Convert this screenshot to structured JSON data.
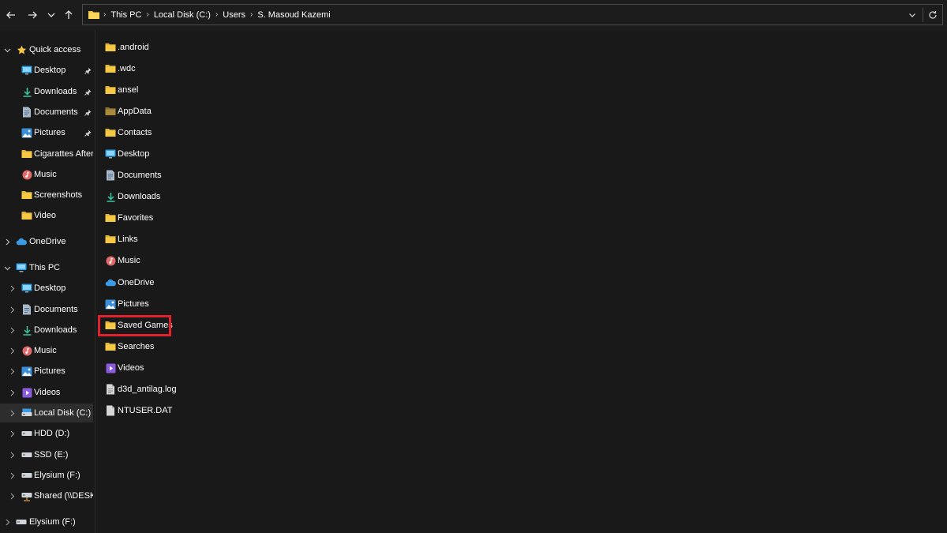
{
  "toolbar": {
    "back_icon": "arrow-left-icon",
    "forward_icon": "arrow-right-icon",
    "recent_icon": "chevron-down-icon",
    "up_icon": "arrow-up-icon"
  },
  "address": {
    "crumbs": [
      "This PC",
      "Local Disk (C:)",
      "Users",
      "S. Masoud Kazemi"
    ],
    "dropdown_icon": "chevron-down-icon",
    "refresh_icon": "refresh-icon"
  },
  "sidebar": {
    "quick_access": {
      "label": "Quick access",
      "items": [
        {
          "label": "Desktop",
          "icon": "desktop-icon",
          "pinned": true
        },
        {
          "label": "Downloads",
          "icon": "download-icon",
          "pinned": true
        },
        {
          "label": "Documents",
          "icon": "document-icon",
          "pinned": true
        },
        {
          "label": "Pictures",
          "icon": "pictures-icon",
          "pinned": true
        },
        {
          "label": "Cigarattes After Se",
          "icon": "folder-icon",
          "pinned": false
        },
        {
          "label": "Music",
          "icon": "music-icon",
          "pinned": false
        },
        {
          "label": "Screenshots",
          "icon": "folder-icon",
          "pinned": false
        },
        {
          "label": "Video",
          "icon": "folder-icon",
          "pinned": false
        }
      ]
    },
    "onedrive": {
      "label": "OneDrive"
    },
    "this_pc": {
      "label": "This PC",
      "items": [
        {
          "label": "Desktop",
          "icon": "desktop-icon"
        },
        {
          "label": "Documents",
          "icon": "document-icon"
        },
        {
          "label": "Downloads",
          "icon": "download-icon"
        },
        {
          "label": "Music",
          "icon": "music-icon"
        },
        {
          "label": "Pictures",
          "icon": "pictures-icon"
        },
        {
          "label": "Videos",
          "icon": "videos-icon"
        },
        {
          "label": "Local Disk (C:)",
          "icon": "drive-icon",
          "selected": true
        },
        {
          "label": "HDD (D:)",
          "icon": "drive-icon"
        },
        {
          "label": "SSD (E:)",
          "icon": "drive-icon"
        },
        {
          "label": "Elysium (F:)",
          "icon": "drive-icon"
        },
        {
          "label": "Shared (\\\\DESKTOI",
          "icon": "network-drive-icon"
        }
      ]
    },
    "elysium": {
      "label": "Elysium (F:)"
    }
  },
  "files": [
    {
      "name": ".android",
      "icon": "folder-icon"
    },
    {
      "name": ".wdc",
      "icon": "folder-icon"
    },
    {
      "name": "ansel",
      "icon": "folder-icon"
    },
    {
      "name": "AppData",
      "icon": "folder-dim-icon"
    },
    {
      "name": "Contacts",
      "icon": "folder-icon"
    },
    {
      "name": "Desktop",
      "icon": "desktop-icon"
    },
    {
      "name": "Documents",
      "icon": "document-icon"
    },
    {
      "name": "Downloads",
      "icon": "download-icon"
    },
    {
      "name": "Favorites",
      "icon": "folder-icon"
    },
    {
      "name": "Links",
      "icon": "folder-icon"
    },
    {
      "name": "Music",
      "icon": "music-icon"
    },
    {
      "name": "OneDrive",
      "icon": "cloud-icon"
    },
    {
      "name": "Pictures",
      "icon": "pictures-icon"
    },
    {
      "name": "Saved Games",
      "icon": "folder-icon",
      "highlighted": true
    },
    {
      "name": "Searches",
      "icon": "folder-icon"
    },
    {
      "name": "Videos",
      "icon": "videos-icon"
    },
    {
      "name": "d3d_antilag.log",
      "icon": "file-icon"
    },
    {
      "name": "NTUSER.DAT",
      "icon": "file-icon"
    }
  ],
  "colors": {
    "background": "#191919",
    "folder": "#f6c944",
    "folder_dim": "#a88a3a",
    "highlight": "#e3202b",
    "selected_bg": "#2d2d2d"
  }
}
